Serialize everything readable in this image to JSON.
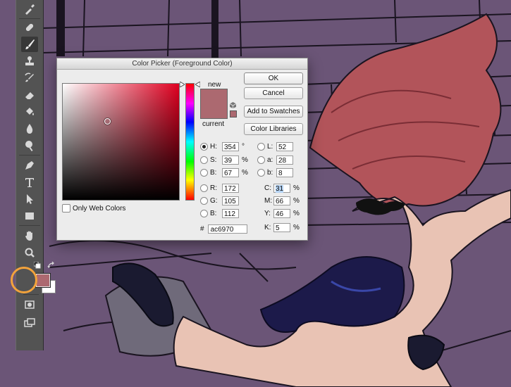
{
  "dialog": {
    "title": "Color Picker (Foreground Color)",
    "new_label": "new",
    "current_label": "current",
    "only_web_colors": "Only Web Colors",
    "new_color": "#ac6970",
    "buttons": {
      "ok": "OK",
      "cancel": "Cancel",
      "add_to_swatches": "Add to Swatches",
      "color_libraries": "Color Libraries"
    },
    "hsb": {
      "h_label": "H:",
      "h_value": "354",
      "h_unit": "°",
      "s_label": "S:",
      "s_value": "39",
      "s_unit": "%",
      "b_label": "B:",
      "b_value": "67",
      "b_unit": "%"
    },
    "rgb": {
      "r_label": "R:",
      "r_value": "172",
      "g_label": "G:",
      "g_value": "105",
      "b_label": "B:",
      "b_value": "112"
    },
    "lab": {
      "l_label": "L:",
      "l_value": "52",
      "a_label": "a:",
      "a_value": "28",
      "b_label": "b:",
      "b_value": "8"
    },
    "cmyk": {
      "c_label": "C:",
      "c_value": "31",
      "c_unit": "%",
      "m_label": "M:",
      "m_value": "66",
      "m_unit": "%",
      "y_label": "Y:",
      "y_value": "46",
      "y_unit": "%",
      "k_label": "K:",
      "k_value": "5",
      "k_unit": "%"
    },
    "hex_label": "#",
    "hex_value": "ac6970"
  },
  "toolbar": {
    "tools": [
      "eyedropper-icon",
      "healing-brush-icon",
      "brush-icon",
      "clone-stamp-icon",
      "history-brush-icon",
      "eraser-icon",
      "paint-bucket-icon",
      "blur-icon",
      "dodge-icon",
      "pen-icon",
      "type-icon",
      "path-selection-icon",
      "rectangle-icon",
      "hand-icon",
      "zoom-icon"
    ],
    "foreground_color": "#ac6970",
    "background_color": "#ffffff",
    "highlight_color": "#f3a33b"
  },
  "canvas": {
    "background_color": "#6b5577",
    "hair_color": "#b2545a",
    "skin_color": "#e9c3b4",
    "costume_color": "#1c1a4a"
  }
}
